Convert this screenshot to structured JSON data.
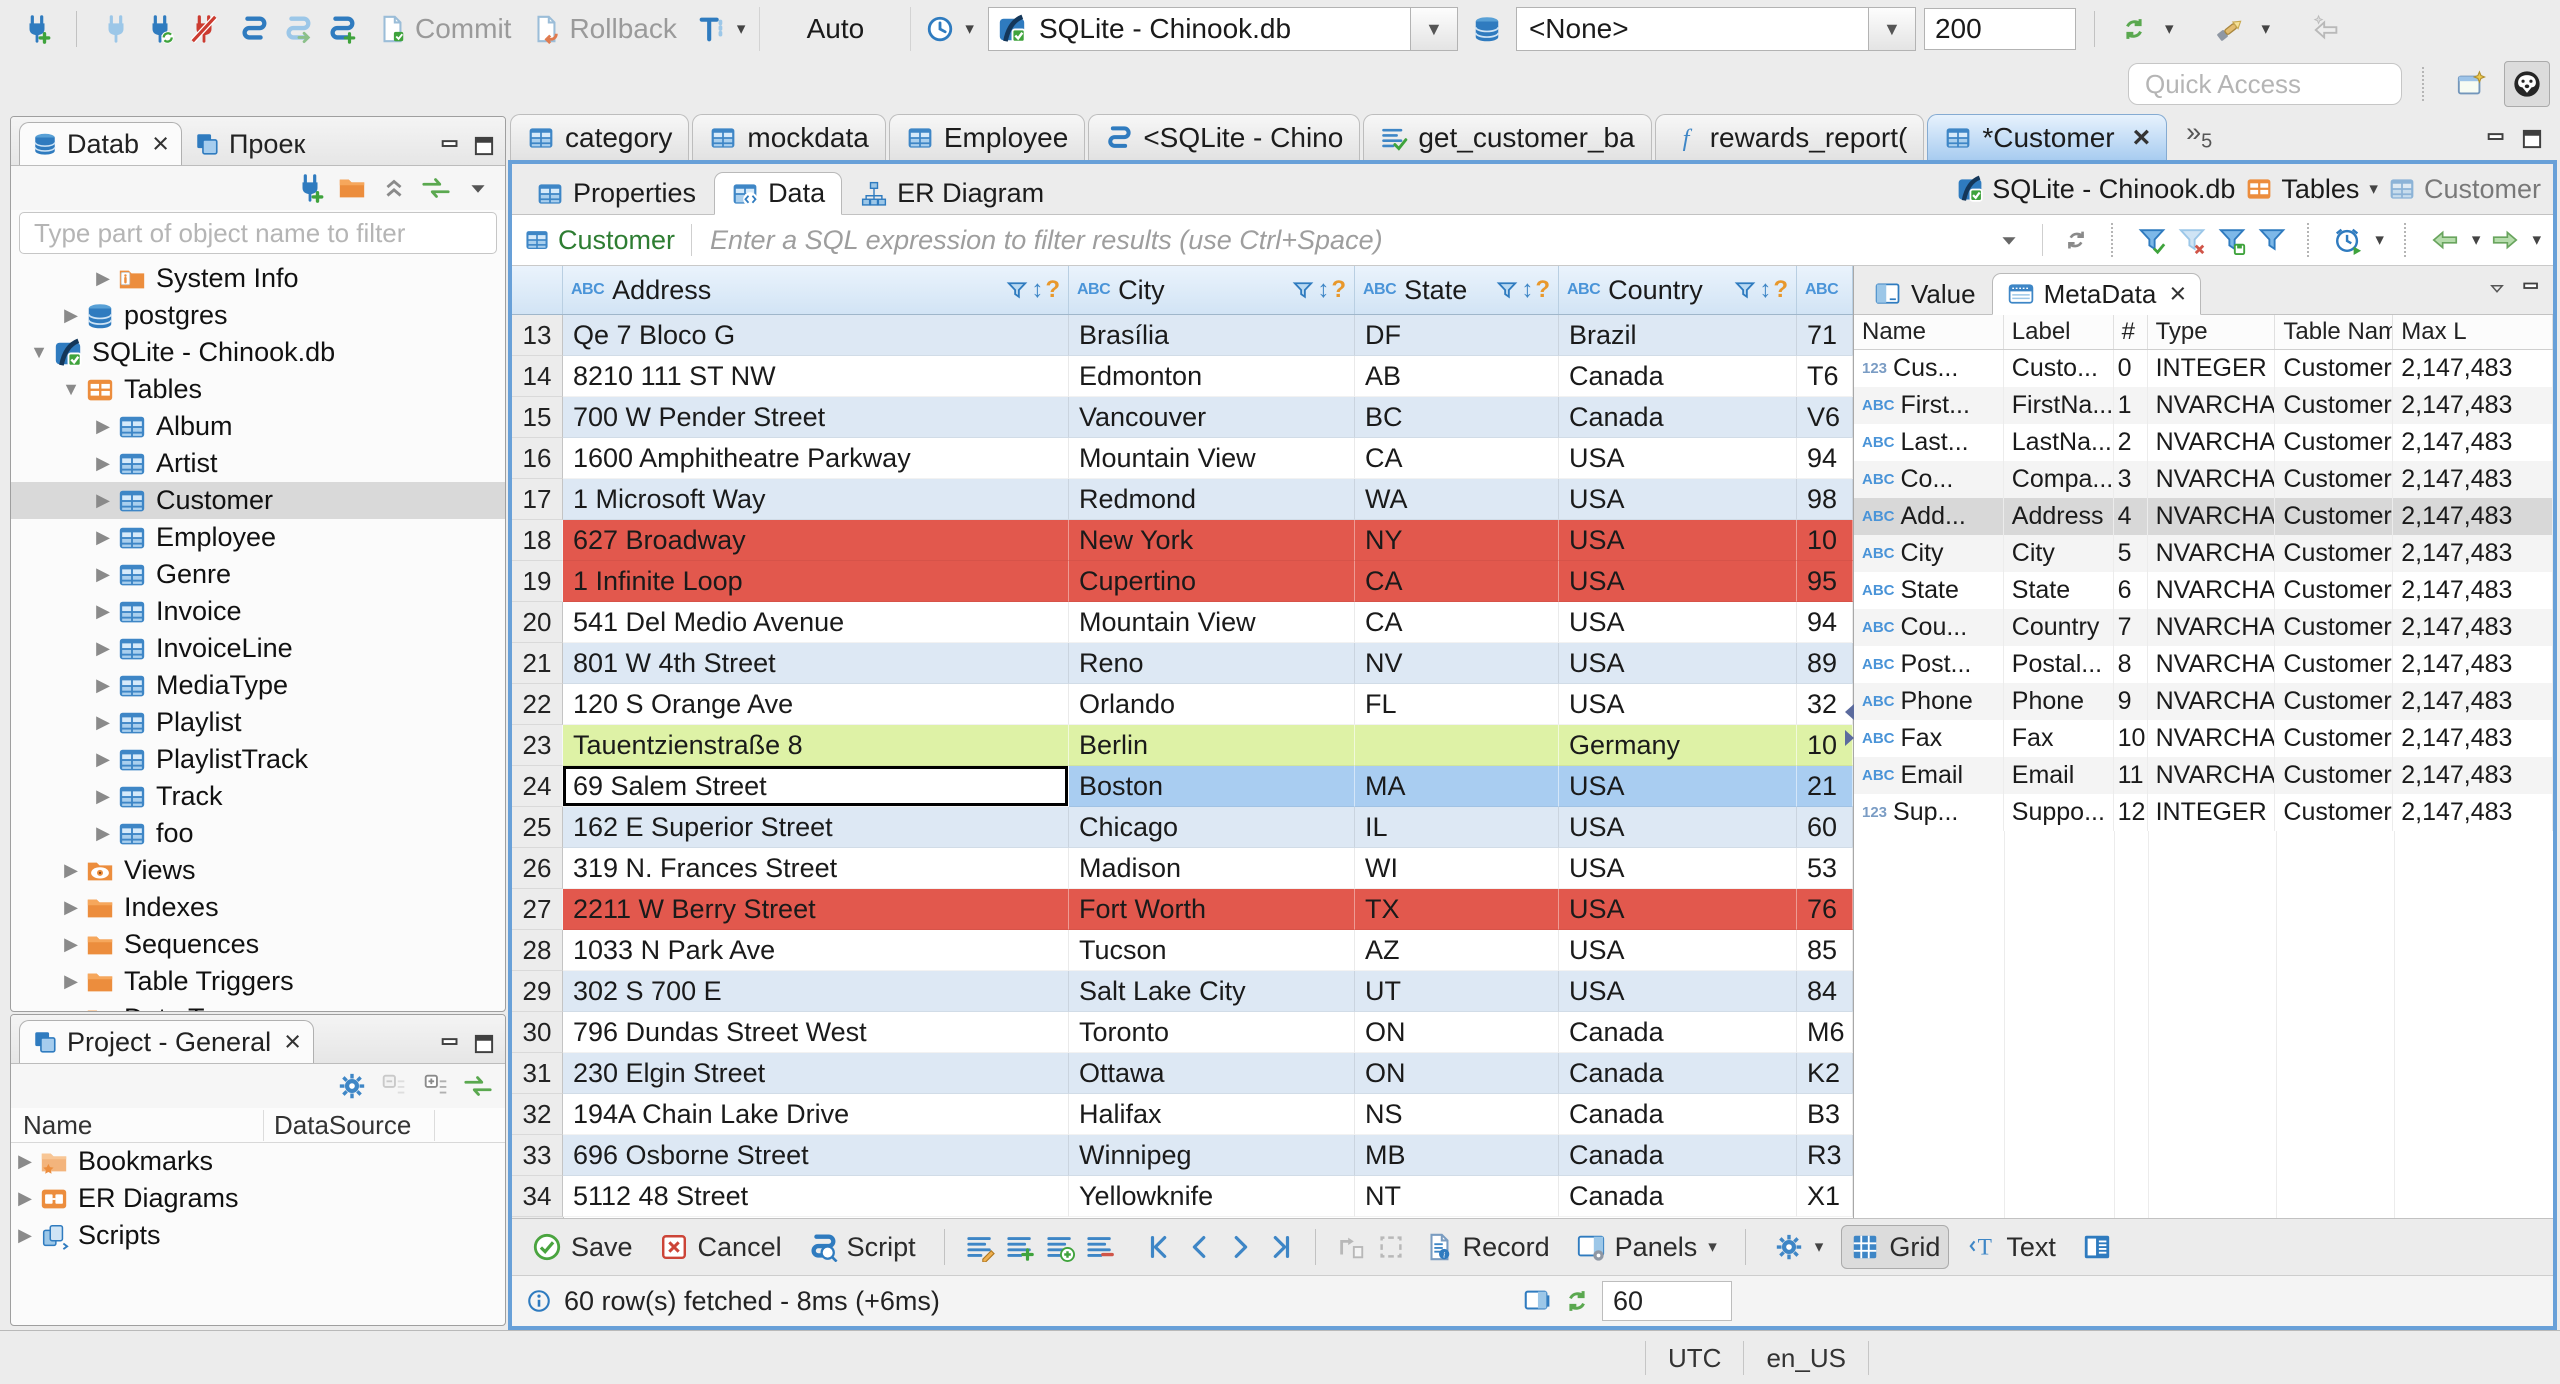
{
  "main_toolbar": {
    "connection_groups": [
      [
        "new-connection"
      ],
      [
        "connect",
        "reconnect",
        "disconnect"
      ],
      [
        "sql-editor",
        "new-sql-editor",
        "open-sql-script"
      ]
    ],
    "commit_label": "Commit",
    "commit_icon": "commit-file",
    "rollback_label": "Rollback",
    "rollback_icon": "rollback-file",
    "txn_icon": "transaction-mode",
    "auto_combo": "Auto",
    "history_icon": "history-clock",
    "connection_combo": {
      "icon": "sqlite-db",
      "value": "SQLite - Chinook.db"
    },
    "database_icon": "database-stack",
    "schema_combo": {
      "value": "<None>"
    },
    "fetch_size": "200",
    "right_icons": [
      "auto-sync",
      "search-flashlight",
      "back-disabled"
    ],
    "quick_access_placeholder": "Quick Access",
    "perspective_icons": [
      "open-perspective",
      "dbeaver-perspective"
    ]
  },
  "navigator": {
    "tabs": [
      {
        "label": "Datab",
        "icon": "database-stack",
        "active": true,
        "closable": true
      },
      {
        "label": "Проек",
        "icon": "projects"
      }
    ],
    "window_icons": [
      "minimize",
      "maximize"
    ],
    "toolbar_icons": [
      "new-connection",
      "new-folder",
      "collapse-all",
      "link-with-editor",
      "view-menu"
    ],
    "filter_placeholder": "Type part of object name to filter",
    "tree": [
      {
        "label": "System Info",
        "depth": 2,
        "icon": "info-folder",
        "arrow": "right"
      },
      {
        "label": "postgres",
        "depth": 1,
        "icon": "database",
        "arrow": "right"
      },
      {
        "label": "SQLite - Chinook.db",
        "depth": 0,
        "icon": "sqlite-db",
        "arrow": "down"
      },
      {
        "label": "Tables",
        "depth": 1,
        "icon": "tables-folder",
        "arrow": "down"
      },
      {
        "label": "Album",
        "depth": 2,
        "icon": "table",
        "arrow": "right"
      },
      {
        "label": "Artist",
        "depth": 2,
        "icon": "table",
        "arrow": "right"
      },
      {
        "label": "Customer",
        "depth": 2,
        "icon": "table",
        "arrow": "right",
        "selected": true
      },
      {
        "label": "Employee",
        "depth": 2,
        "icon": "table",
        "arrow": "right"
      },
      {
        "label": "Genre",
        "depth": 2,
        "icon": "table",
        "arrow": "right"
      },
      {
        "label": "Invoice",
        "depth": 2,
        "icon": "table",
        "arrow": "right"
      },
      {
        "label": "InvoiceLine",
        "depth": 2,
        "icon": "table",
        "arrow": "right"
      },
      {
        "label": "MediaType",
        "depth": 2,
        "icon": "table",
        "arrow": "right"
      },
      {
        "label": "Playlist",
        "depth": 2,
        "icon": "table",
        "arrow": "right"
      },
      {
        "label": "PlaylistTrack",
        "depth": 2,
        "icon": "table",
        "arrow": "right"
      },
      {
        "label": "Track",
        "depth": 2,
        "icon": "table",
        "arrow": "right"
      },
      {
        "label": "foo",
        "depth": 2,
        "icon": "table",
        "arrow": "right"
      },
      {
        "label": "Views",
        "depth": 1,
        "icon": "views-folder",
        "arrow": "right"
      },
      {
        "label": "Indexes",
        "depth": 1,
        "icon": "folder",
        "arrow": "right"
      },
      {
        "label": "Sequences",
        "depth": 1,
        "icon": "folder",
        "arrow": "right"
      },
      {
        "label": "Table Triggers",
        "depth": 1,
        "icon": "folder",
        "arrow": "right"
      },
      {
        "label": "Data Types",
        "depth": 1,
        "icon": "folder",
        "arrow": "right"
      }
    ]
  },
  "project_panel": {
    "title": "Project - General",
    "icon": "projects",
    "window_icons": [
      "minimize",
      "maximize"
    ],
    "toolbar_icons": [
      "settings-gear",
      "collapse-disabled",
      "expand-all",
      "link-with-editor"
    ],
    "columns": [
      "Name",
      "DataSource"
    ],
    "tree": [
      {
        "label": "Bookmarks",
        "icon": "bookmarks-folder",
        "arrow": "right"
      },
      {
        "label": "ER Diagrams",
        "icon": "er-diagrams",
        "arrow": "right"
      },
      {
        "label": "Scripts",
        "icon": "scripts",
        "arrow": "right"
      }
    ]
  },
  "editor": {
    "tabs": [
      {
        "label": "category",
        "icon": "table"
      },
      {
        "label": "mockdata",
        "icon": "table"
      },
      {
        "label": "Employee",
        "icon": "table"
      },
      {
        "label": "<SQLite - Chino",
        "icon": "sql-editor"
      },
      {
        "label": "get_customer_ba",
        "icon": "sql-script-check"
      },
      {
        "label": "rewards_report(",
        "icon": "function"
      },
      {
        "label": "*Customer",
        "icon": "table",
        "active": true,
        "closable": true
      }
    ],
    "overflow_count": "5",
    "window_icons": [
      "minimize",
      "maximize"
    ]
  },
  "result_view": {
    "subtabs": [
      {
        "label": "Properties",
        "icon": "properties"
      },
      {
        "label": "Data",
        "icon": "data-grid",
        "active": true
      },
      {
        "label": "ER Diagram",
        "icon": "er-diagram"
      }
    ],
    "breadcrumb": [
      {
        "label": "SQLite - Chinook.db",
        "icon": "sqlite-db"
      },
      {
        "label": "Tables",
        "icon": "tables-folder",
        "dropdown": true
      },
      {
        "label": "Customer",
        "icon": "table",
        "disabled": true
      }
    ],
    "filter_bar": {
      "entity": "Customer",
      "entity_icon": "table",
      "placeholder": "Enter a SQL expression to filter results (use Ctrl+Space)",
      "icons": [
        "filter-dropdown",
        "refresh",
        "filter-apply",
        "filter-remove",
        "filter-save",
        "filter-custom",
        "auto-refresh-timer",
        "fetch-prev",
        "fetch-next"
      ]
    },
    "grid": {
      "columns": [
        "Address",
        "City",
        "State",
        "Country",
        ""
      ],
      "rows": [
        {
          "num": "13",
          "style": "odd",
          "cells": [
            "Qe 7 Bloco G",
            "Brasília",
            "DF",
            "Brazil",
            "71"
          ]
        },
        {
          "num": "14",
          "style": "even",
          "cells": [
            "8210 111 ST NW",
            "Edmonton",
            "AB",
            "Canada",
            "T6"
          ]
        },
        {
          "num": "15",
          "style": "odd",
          "cells": [
            "700 W Pender Street",
            "Vancouver",
            "BC",
            "Canada",
            "V6"
          ]
        },
        {
          "num": "16",
          "style": "even",
          "cells": [
            "1600 Amphitheatre Parkway",
            "Mountain View",
            "CA",
            "USA",
            "94"
          ]
        },
        {
          "num": "17",
          "style": "odd",
          "cells": [
            "1 Microsoft Way",
            "Redmond",
            "WA",
            "USA",
            "98"
          ]
        },
        {
          "num": "18",
          "style": "error",
          "cells": [
            "627 Broadway",
            "New York",
            "NY",
            "USA",
            "10"
          ]
        },
        {
          "num": "19",
          "style": "error",
          "cells": [
            "1 Infinite Loop",
            "Cupertino",
            "CA",
            "USA",
            "95"
          ]
        },
        {
          "num": "20",
          "style": "even",
          "cells": [
            "541 Del Medio Avenue",
            "Mountain View",
            "CA",
            "USA",
            "94"
          ]
        },
        {
          "num": "21",
          "style": "odd",
          "cells": [
            "801 W 4th Street",
            "Reno",
            "NV",
            "USA",
            "89"
          ]
        },
        {
          "num": "22",
          "style": "even",
          "cells": [
            "120 S Orange Ave",
            "Orlando",
            "FL",
            "USA",
            "32"
          ]
        },
        {
          "num": "23",
          "style": "success",
          "cells": [
            "Tauentzienstraße 8",
            "Berlin",
            "",
            "Germany",
            "10"
          ]
        },
        {
          "num": "24",
          "style": "selected",
          "cells": [
            "69 Salem Street",
            "Boston",
            "MA",
            "USA",
            "21"
          ]
        },
        {
          "num": "25",
          "style": "odd",
          "cells": [
            "162 E Superior Street",
            "Chicago",
            "IL",
            "USA",
            "60"
          ]
        },
        {
          "num": "26",
          "style": "even",
          "cells": [
            "319 N. Frances Street",
            "Madison",
            "WI",
            "USA",
            "53"
          ]
        },
        {
          "num": "27",
          "style": "error",
          "cells": [
            "2211 W Berry Street",
            "Fort Worth",
            "TX",
            "USA",
            "76"
          ]
        },
        {
          "num": "28",
          "style": "even",
          "cells": [
            "1033 N Park Ave",
            "Tucson",
            "AZ",
            "USA",
            "85"
          ]
        },
        {
          "num": "29",
          "style": "odd",
          "cells": [
            "302 S 700 E",
            "Salt Lake City",
            "UT",
            "USA",
            "84"
          ]
        },
        {
          "num": "30",
          "style": "even",
          "cells": [
            "796 Dundas Street West",
            "Toronto",
            "ON",
            "Canada",
            "M6"
          ]
        },
        {
          "num": "31",
          "style": "odd",
          "cells": [
            "230 Elgin Street",
            "Ottawa",
            "ON",
            "Canada",
            "K2"
          ]
        },
        {
          "num": "32",
          "style": "even",
          "cells": [
            "194A Chain Lake Drive",
            "Halifax",
            "NS",
            "Canada",
            "B3"
          ]
        },
        {
          "num": "33",
          "style": "odd",
          "cells": [
            "696 Osborne Street",
            "Winnipeg",
            "MB",
            "Canada",
            "R3"
          ]
        },
        {
          "num": "34",
          "style": "even",
          "cells": [
            "5112 48 Street",
            "Yellowknife",
            "NT",
            "Canada",
            "X1"
          ]
        }
      ],
      "focus_cell": {
        "row": "24",
        "column": "Address"
      }
    },
    "side_panel": {
      "tabs": [
        {
          "label": "Value",
          "icon": "value-panel"
        },
        {
          "label": "MetaData",
          "icon": "metadata-panel",
          "active": true,
          "closable": true
        }
      ],
      "window_icons": [
        "panel-menu",
        "minimize"
      ],
      "columns": [
        "Name",
        "Label",
        "#",
        "Type",
        "Table Name",
        "Max L"
      ],
      "rows": [
        {
          "kind": "int",
          "name": "Cus...",
          "label": "Custo...",
          "num": "0",
          "type": "INTEGER",
          "table": "Customer",
          "max": "2,147,483"
        },
        {
          "kind": "str",
          "name": "First...",
          "label": "FirstNa...",
          "num": "1",
          "type": "NVARCHAR",
          "table": "Customer",
          "max": "2,147,483"
        },
        {
          "kind": "str",
          "name": "Last...",
          "label": "LastNa...",
          "num": "2",
          "type": "NVARCHAR",
          "table": "Customer",
          "max": "2,147,483"
        },
        {
          "kind": "str",
          "name": "Co...",
          "label": "Compa...",
          "num": "3",
          "type": "NVARCHAR",
          "table": "Customer",
          "max": "2,147,483"
        },
        {
          "kind": "str",
          "name": "Add...",
          "label": "Address",
          "num": "4",
          "type": "NVARCHAR",
          "table": "Customer",
          "max": "2,147,483",
          "selected": true
        },
        {
          "kind": "str",
          "name": "City",
          "label": "City",
          "num": "5",
          "type": "NVARCHAR",
          "table": "Customer",
          "max": "2,147,483"
        },
        {
          "kind": "str",
          "name": "State",
          "label": "State",
          "num": "6",
          "type": "NVARCHAR",
          "table": "Customer",
          "max": "2,147,483"
        },
        {
          "kind": "str",
          "name": "Cou...",
          "label": "Country",
          "num": "7",
          "type": "NVARCHAR",
          "table": "Customer",
          "max": "2,147,483"
        },
        {
          "kind": "str",
          "name": "Post...",
          "label": "Postal...",
          "num": "8",
          "type": "NVARCHAR",
          "table": "Customer",
          "max": "2,147,483"
        },
        {
          "kind": "str",
          "name": "Phone",
          "label": "Phone",
          "num": "9",
          "type": "NVARCHAR",
          "table": "Customer",
          "max": "2,147,483"
        },
        {
          "kind": "str",
          "name": "Fax",
          "label": "Fax",
          "num": "10",
          "type": "NVARCHAR",
          "table": "Customer",
          "max": "2,147,483"
        },
        {
          "kind": "str",
          "name": "Email",
          "label": "Email",
          "num": "11",
          "type": "NVARCHAR",
          "table": "Customer",
          "max": "2,147,483"
        },
        {
          "kind": "int",
          "name": "Sup...",
          "label": "Suppo...",
          "num": "12",
          "type": "INTEGER",
          "table": "Customer",
          "max": "2,147,483"
        }
      ]
    },
    "bottom_toolbar": {
      "save": "Save",
      "cancel": "Cancel",
      "script": "Script",
      "save_icon": "save-ok",
      "cancel_icon": "cancel-x",
      "script_icon": "script-doc",
      "edit_icons": [
        "edit-row",
        "add-row",
        "copy-row",
        "delete-row"
      ],
      "nav_icons": [
        "nav-first",
        "nav-prev",
        "nav-next",
        "nav-last"
      ],
      "disabled_icons": [
        "goto-row-disabled",
        "select-row-disabled"
      ],
      "record": "Record",
      "record_icon": "record-form",
      "panels": "Panels",
      "panels_icon": "panels",
      "settings_icon": "settings-gear",
      "grid": "Grid",
      "grid_icon": "grid-view",
      "text": "Text",
      "text_icon": "text-view",
      "value_view_icon": "value-view"
    },
    "status": {
      "info_icon": "info",
      "message": "60 row(s) fetched - 8ms (+6ms)",
      "right_icons": [
        "panel-toggle",
        "refresh-green"
      ],
      "refresh_value": "60"
    }
  },
  "statusbar": {
    "timezone": "UTC",
    "locale": "en_US"
  }
}
